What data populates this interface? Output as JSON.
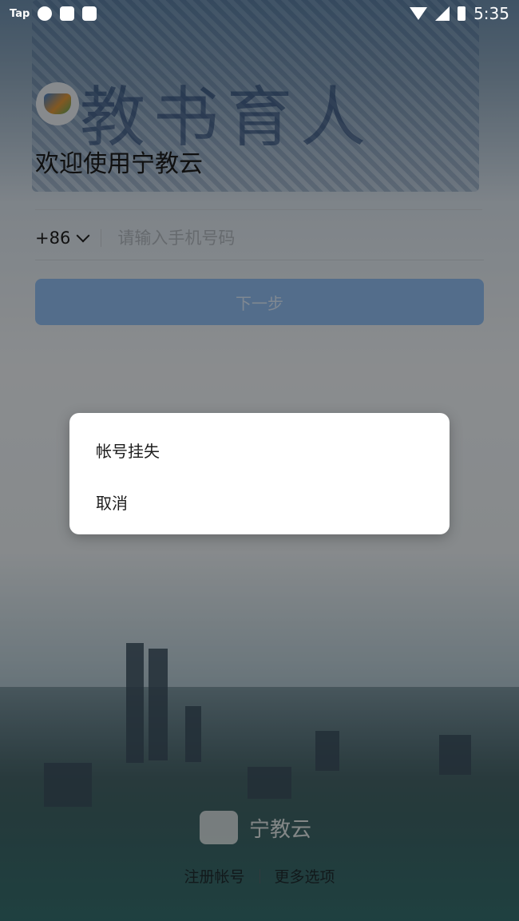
{
  "status_bar": {
    "carrier_label": "Tap",
    "time": "5:35"
  },
  "background": {
    "calligraphy_text": "教书育人"
  },
  "login": {
    "welcome_title": "欢迎使用宁教云",
    "country_code": "+86",
    "phone_placeholder": "请输入手机号码",
    "next_button_label": "下一步"
  },
  "footer": {
    "brand_text": "宁教云",
    "register_link": "注册帐号",
    "more_options_link": "更多选项"
  },
  "dialog": {
    "items": [
      {
        "label": "帐号挂失"
      },
      {
        "label": "取消"
      }
    ]
  },
  "colors": {
    "primary_button": "#8fbcf0",
    "overlay": "rgba(0,0,0,0.42)"
  }
}
